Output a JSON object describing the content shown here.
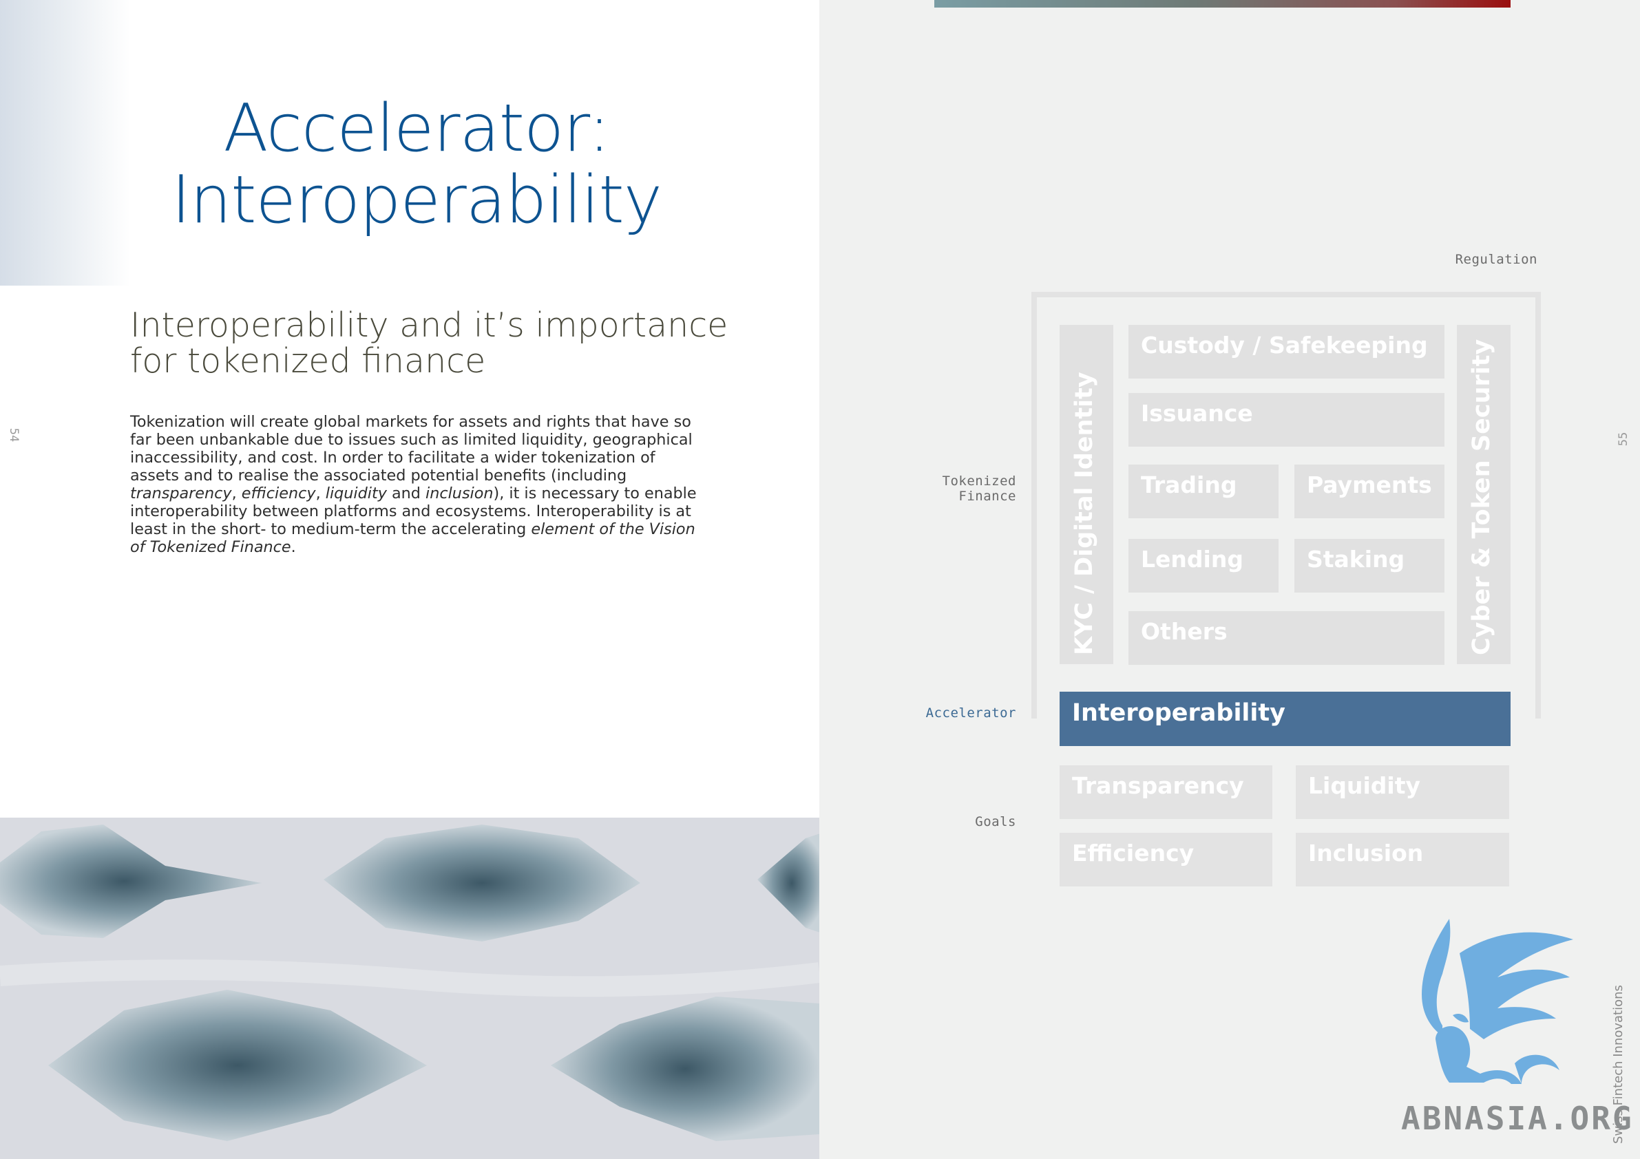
{
  "left_page": {
    "page_number": "54",
    "title_line1": "Accelerator:",
    "title_line2": "Interoperability",
    "subtitle_line1": "Interoperability and it’s importance",
    "subtitle_line2": "for tokenized finance",
    "body": {
      "p1": "Tokenization will create global markets for assets and rights that have so far been unbankable due to issues such as limited liquidity, geographical inaccessibility, and cost. In order to facilitate a wider tokenization of assets and to realise the associated potential benefits (including ",
      "i1": "transparency",
      "s1": ", ",
      "i2": "efficiency",
      "s2": ", ",
      "i3": "liquidity",
      "s3": " and ",
      "i4": "inclusion",
      "p2": "), it is necessary to enable interoperability between platforms and ecosystems. Interoperability is at least in the short- to medium-term the accelerating ",
      "i5": "element of the Vision of Tokenized Finance",
      "p3": "."
    }
  },
  "right_page": {
    "page_number": "55",
    "labels": {
      "regulation": "Regulation",
      "tokenized_finance_l1": "Tokenized",
      "tokenized_finance_l2": "Finance",
      "accelerator": "Accelerator",
      "goals": "Goals"
    },
    "pillars": {
      "left": "KYC / Digital Identity",
      "right": "Cyber & Token Security"
    },
    "blocks": {
      "custody": "Custody / Safekeeping",
      "issuance": "Issuance",
      "trading": "Trading",
      "payments": "Payments",
      "lending": "Lending",
      "staking": "Staking",
      "others": "Others"
    },
    "accelerator_block": "Interoperability",
    "goals": {
      "transparency": "Transparency",
      "liquidity": "Liquidity",
      "efficiency": "Efficiency",
      "inclusion": "Inclusion"
    },
    "side_brand": "Swiss Fintech Innovations",
    "watermark": "ABNASIA.ORG",
    "accent_color": "#4a7097",
    "title_color": "#0d5391",
    "icons": [
      "griffin-logo-icon"
    ]
  }
}
